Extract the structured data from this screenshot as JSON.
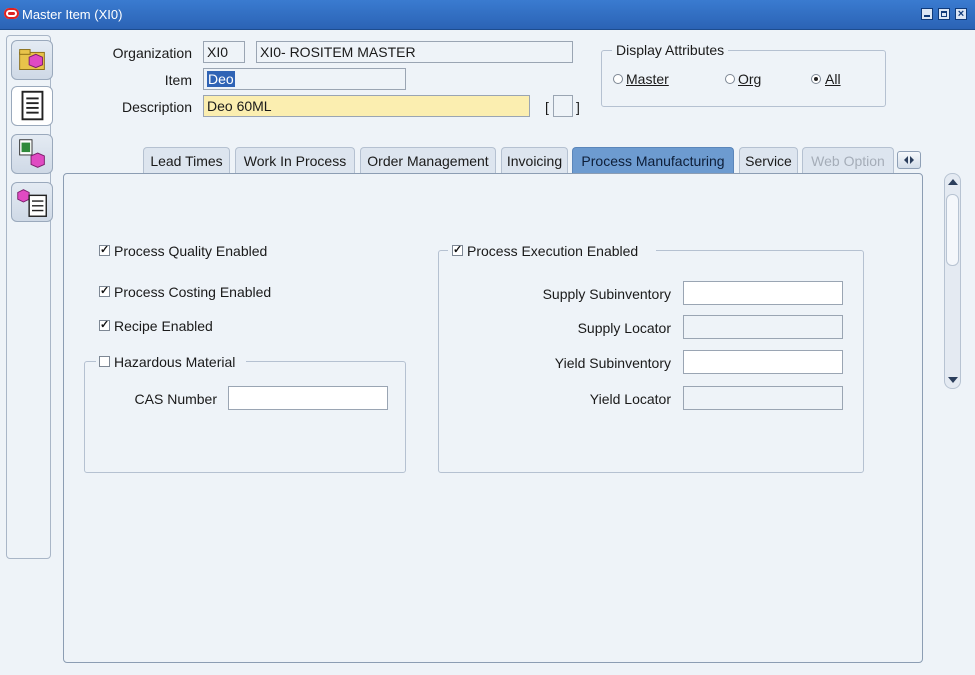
{
  "window": {
    "title": "Master Item (XI0)"
  },
  "header": {
    "organization_label": "Organization",
    "organization_code": "XI0",
    "organization_name": "XI0- ROSITEM MASTER",
    "item_label": "Item",
    "item_value": "Deo",
    "description_label": "Description",
    "description_value": "Deo 60ML",
    "bracket_open": "[",
    "bracket_close": "]"
  },
  "display_attributes": {
    "title": "Display Attributes",
    "options": [
      {
        "label": "Master",
        "selected": false
      },
      {
        "label": "Org",
        "selected": false
      },
      {
        "label": "All",
        "selected": true
      }
    ]
  },
  "toolbar": {
    "icons": [
      "folder-item-icon",
      "document-list-icon",
      "catalog-cube-icon",
      "item-list-icon"
    ]
  },
  "tabs": [
    {
      "label": "Lead Times",
      "state": "normal"
    },
    {
      "label": "Work In Process",
      "state": "normal"
    },
    {
      "label": "Order Management",
      "state": "normal"
    },
    {
      "label": "Invoicing",
      "state": "normal"
    },
    {
      "label": "Process Manufacturing",
      "state": "active"
    },
    {
      "label": "Service",
      "state": "normal"
    },
    {
      "label": "Web Option",
      "state": "disabled"
    }
  ],
  "process_manufacturing": {
    "quality_enabled": {
      "label": "Process Quality Enabled",
      "checked": true
    },
    "costing_enabled": {
      "label": "Process Costing Enabled",
      "checked": true
    },
    "recipe_enabled": {
      "label": "Recipe Enabled",
      "checked": true
    },
    "hazardous_material": {
      "label": "Hazardous Material",
      "checked": false
    },
    "cas_number": {
      "label": "CAS Number",
      "value": ""
    },
    "execution_enabled": {
      "label": "Process Execution Enabled",
      "checked": true
    },
    "supply_subinventory": {
      "label": "Supply Subinventory",
      "value": ""
    },
    "supply_locator": {
      "label": "Supply Locator",
      "value": ""
    },
    "yield_subinventory": {
      "label": "Yield Subinventory",
      "value": ""
    },
    "yield_locator": {
      "label": "Yield Locator",
      "value": ""
    }
  },
  "colors": {
    "title_bar": "#2b63b5",
    "active_tab": "#6d9bd0",
    "required_field": "#fbeeb0",
    "background": "#eef3f8"
  }
}
